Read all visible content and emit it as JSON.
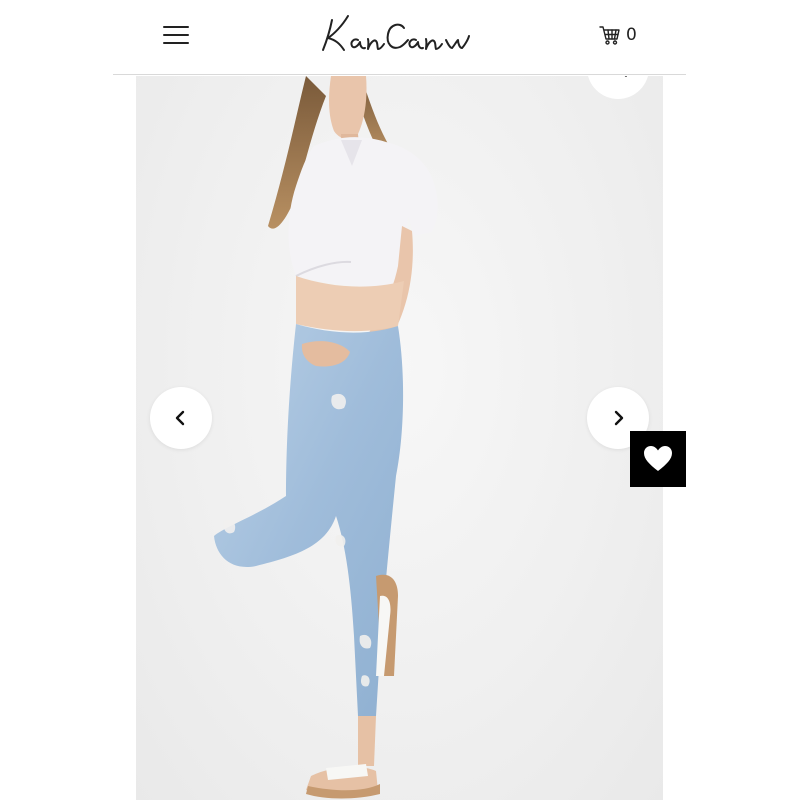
{
  "header": {
    "menu_icon": "hamburger-menu-icon",
    "logo_text": "KanCan",
    "cart_icon": "shopping-cart-icon",
    "cart_count": "0"
  },
  "gallery": {
    "zoom_icon": "zoom-magnifier-icon",
    "prev_icon": "chevron-left-icon",
    "next_icon": "chevron-right-icon"
  },
  "wishlist": {
    "icon": "heart-icon",
    "background": "#000000",
    "icon_color": "#ffffff"
  },
  "colors": {
    "text": "#222222",
    "divider": "#d9d9d9",
    "photo_background": "#efefef",
    "denim": "#a9c3de"
  }
}
